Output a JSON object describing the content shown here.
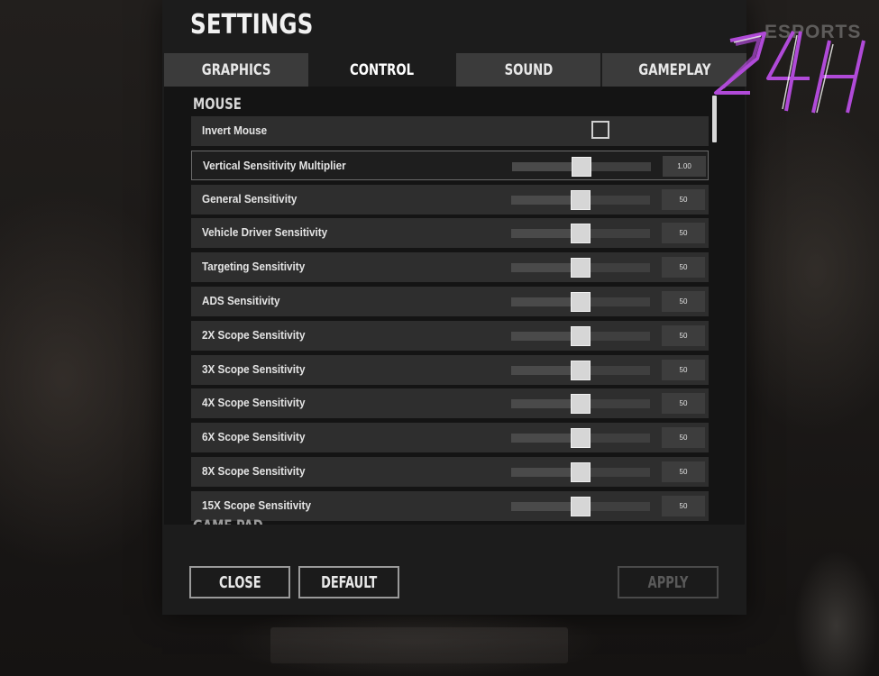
{
  "window": {
    "title": "SETTINGS"
  },
  "tabs": [
    {
      "label": "GRAPHICS",
      "active": false
    },
    {
      "label": "CONTROL",
      "active": true
    },
    {
      "label": "SOUND",
      "active": false
    },
    {
      "label": "GAMEPLAY",
      "active": false
    }
  ],
  "section": {
    "title": "MOUSE",
    "next_title": "GAME PAD"
  },
  "settings": [
    {
      "label": "Invert Mouse",
      "type": "checkbox",
      "checked": false
    },
    {
      "label": "Vertical Sensitivity Multiplier",
      "type": "slider",
      "value_text": "1.00",
      "value": 0.5,
      "selected": true
    },
    {
      "label": "General Sensitivity",
      "type": "slider",
      "value_text": "50",
      "value": 0.5
    },
    {
      "label": "Vehicle Driver Sensitivity",
      "type": "slider",
      "value_text": "50",
      "value": 0.5
    },
    {
      "label": "Targeting Sensitivity",
      "type": "slider",
      "value_text": "50",
      "value": 0.5
    },
    {
      "label": "ADS Sensitivity",
      "type": "slider",
      "value_text": "50",
      "value": 0.5
    },
    {
      "label": "2X Scope Sensitivity",
      "type": "slider",
      "value_text": "50",
      "value": 0.5
    },
    {
      "label": "3X Scope Sensitivity",
      "type": "slider",
      "value_text": "50",
      "value": 0.5
    },
    {
      "label": "4X Scope Sensitivity",
      "type": "slider",
      "value_text": "50",
      "value": 0.5
    },
    {
      "label": "6X Scope Sensitivity",
      "type": "slider",
      "value_text": "50",
      "value": 0.5
    },
    {
      "label": "8X Scope Sensitivity",
      "type": "slider",
      "value_text": "50",
      "value": 0.5
    },
    {
      "label": "15X Scope Sensitivity",
      "type": "slider",
      "value_text": "50",
      "value": 0.5
    }
  ],
  "footer": {
    "close_label": "CLOSE",
    "default_label": "DEFAULT",
    "apply_label": "APPLY",
    "apply_enabled": false
  },
  "watermark": {
    "brand": "24H",
    "tagline": "ESPORTS",
    "color": "#b04ad8"
  },
  "colors": {
    "panel": "#1c1c1c",
    "row": "#2e2e2e",
    "thumb": "#d6d6d6"
  }
}
